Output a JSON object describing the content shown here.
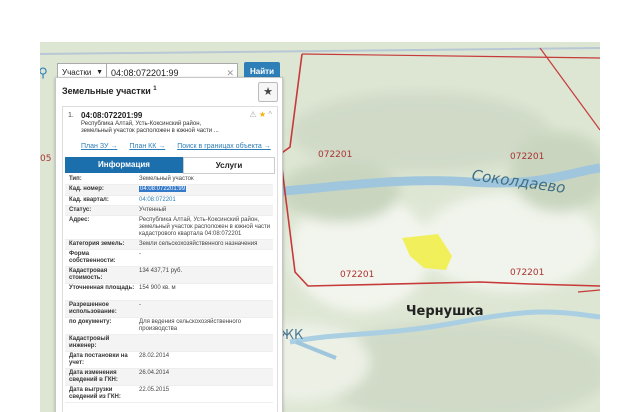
{
  "search": {
    "left_icon": "search-icon",
    "category": "Участки",
    "query": "04:08:072201:99",
    "clear_icon": "close-icon",
    "find_label": "Найти"
  },
  "panel": {
    "title": "Земельные участки",
    "count": "1",
    "favorite_icon": "star-icon"
  },
  "result": {
    "index": "1.",
    "cad_number": "04:08:072201:99",
    "address": "Республика Алтай, Усть-Коксинский район, земельный участок расположен в южной части ...",
    "icons": {
      "warn": "⚠",
      "star": "★",
      "expand": "^"
    },
    "links": {
      "plan_zu": "План ЗУ →",
      "plan_kk": "План КК →",
      "search_in_object": "Поиск в границах объекта →"
    }
  },
  "tabs": {
    "info": "Информация",
    "services": "Услуги"
  },
  "rows": [
    {
      "label": "Тип:",
      "value": "Земельный участок"
    },
    {
      "label": "Кад. номер:",
      "value": "04:08:072201:99"
    },
    {
      "label": "Кад. квартал:",
      "value": "04:08:072201"
    },
    {
      "label": "Статус:",
      "value": "Учтенный"
    },
    {
      "label": "Адрес:",
      "value": "Республика Алтай, Усть-Коксинский район, земельный участок расположен в южной части кадастрового квартала 04:08:072201"
    },
    {
      "label": "Категория земель:",
      "value": "Земли сельскохозяйственного назначения"
    },
    {
      "label": "Форма собственности:",
      "value": "-"
    },
    {
      "label": "Кадастровая стоимость:",
      "value": "134 437,71 руб."
    },
    {
      "label": "Уточненная площадь:",
      "value": "154 900 кв. м"
    },
    {
      "label": "Разрешенное использование:",
      "value": "-"
    },
    {
      "label": "по документу:",
      "value": "Для ведения сельскохозяйственного производства"
    },
    {
      "label": "Кадастровый инженер:",
      "value": ""
    },
    {
      "label": "Дата постановки на учет:",
      "value": "28.02.2014"
    },
    {
      "label": "Дата изменения сведений в ГКН:",
      "value": "26.04.2014"
    },
    {
      "label": "Дата выгрузки сведений из ГКН:",
      "value": "22.05.2015"
    }
  ],
  "map": {
    "labels": {
      "village_1": "Соколдаево",
      "village_2": "Чернушка",
      "edge_left": "05",
      "edge_bottom": "ЖК",
      "parcel_1": "072201",
      "parcel_2": "072201",
      "parcel_3": "072201",
      "parcel_4": "072201"
    },
    "colors": {
      "boundary": "#c63a3a",
      "selected_parcel": "#f1ee4a",
      "river": "#9fc6dc",
      "terrain": "#dfe8d6",
      "accent_blue": "#2e7fb8"
    }
  }
}
